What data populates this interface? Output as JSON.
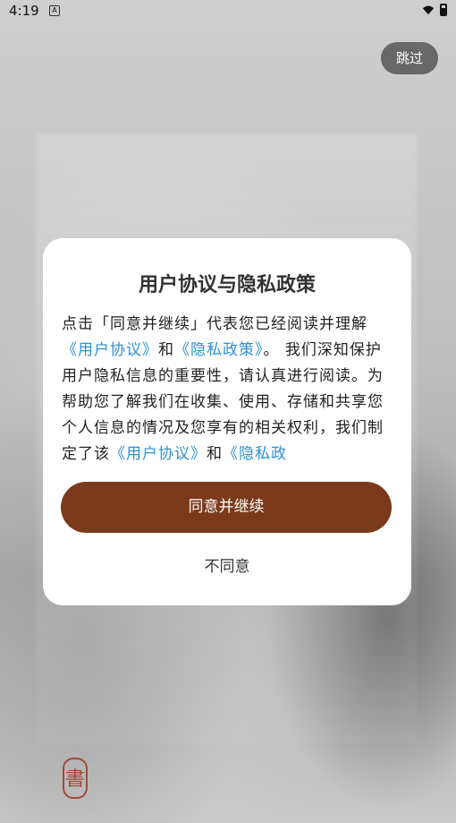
{
  "status_bar": {
    "time": "4:19",
    "notification_badge": "A",
    "icons": [
      "wifi-icon",
      "battery-icon"
    ]
  },
  "skip_button": {
    "label": "跳过"
  },
  "seal": {
    "text": "書"
  },
  "dialog": {
    "title": "用户协议与隐私政策",
    "body": {
      "p1": "点击「同意并继续」代表您已经阅读并理解",
      "link_user": "《用户协议》",
      "and1": "和",
      "link_privacy": "《隐私政策》",
      "p2": "。 我们深知保护用户隐私信息的重要性，请认真进行阅读。为帮助您了解我们在收集、使用、存储和共享您个人信息的情况及您享有的相关权利，我们制定了该",
      "link_user2": "《用户协议》",
      "and2": "和",
      "link_privacy2": "《隐私政"
    },
    "agree_button": "同意并继续",
    "disagree_button": "不同意"
  },
  "colors": {
    "accent": "#7a3a1b",
    "link": "#2f8fd3"
  }
}
